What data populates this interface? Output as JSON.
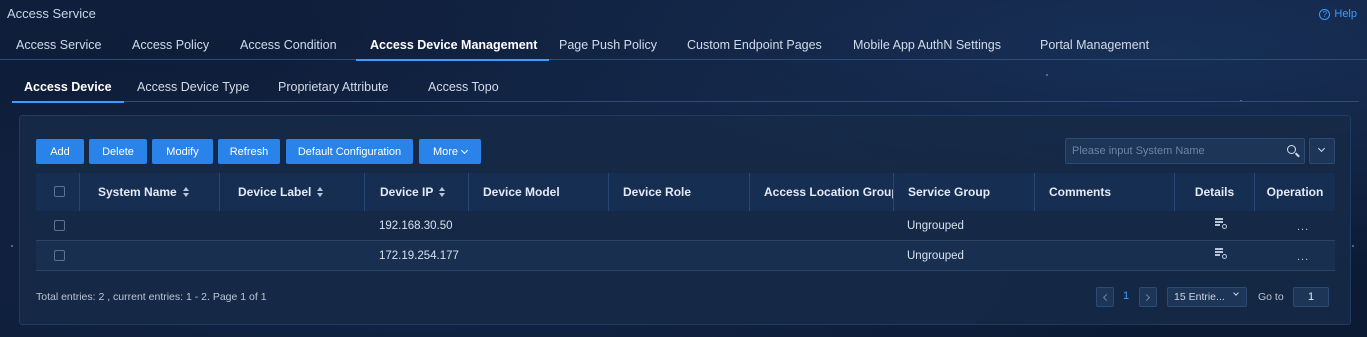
{
  "app": {
    "title": "Access Service",
    "help": "Help"
  },
  "main_tabs": [
    {
      "label": "Access Service"
    },
    {
      "label": "Access Policy"
    },
    {
      "label": "Access Condition"
    },
    {
      "label": "Access Device Management"
    },
    {
      "label": "Page Push Policy"
    },
    {
      "label": "Custom Endpoint Pages"
    },
    {
      "label": "Mobile App AuthN Settings"
    },
    {
      "label": "Portal Management"
    }
  ],
  "active_main_tab": "Access Device Management",
  "sub_tabs": [
    {
      "label": "Access Device"
    },
    {
      "label": "Access Device Type"
    },
    {
      "label": "Proprietary Attribute"
    },
    {
      "label": "Access Topo"
    }
  ],
  "active_sub_tab": "Access Device",
  "toolbar": {
    "add": "Add",
    "delete": "Delete",
    "modify": "Modify",
    "refresh": "Refresh",
    "default_config": "Default Configuration",
    "more": "More"
  },
  "search": {
    "placeholder": "Please input System Name",
    "value": ""
  },
  "table": {
    "columns": [
      "System Name",
      "Device Label",
      "Device IP",
      "Device Model",
      "Device Role",
      "Access Location Group",
      "Service Group",
      "Comments",
      "Details",
      "Operation"
    ],
    "rows": [
      {
        "system_name": "",
        "device_label": "",
        "device_ip": "192.168.30.50",
        "device_model": "",
        "device_role": "",
        "access_location_group": "",
        "service_group": "Ungrouped",
        "comments": "",
        "operation": "..."
      },
      {
        "system_name": "",
        "device_label": "",
        "device_ip": "172.19.254.177",
        "device_model": "",
        "device_role": "",
        "access_location_group": "",
        "service_group": "Ungrouped",
        "comments": "",
        "operation": "..."
      }
    ]
  },
  "pagination": {
    "summary": "Total entries: 2 , current entries: 1 - 2. Page 1 of 1",
    "current_page": "1",
    "page_size": "15 Entrie...",
    "goto_label": "Go to",
    "goto_value": "1"
  },
  "colors": {
    "accent": "#3e9bff",
    "button": "#2a83e8",
    "background": "#0d1a33"
  }
}
